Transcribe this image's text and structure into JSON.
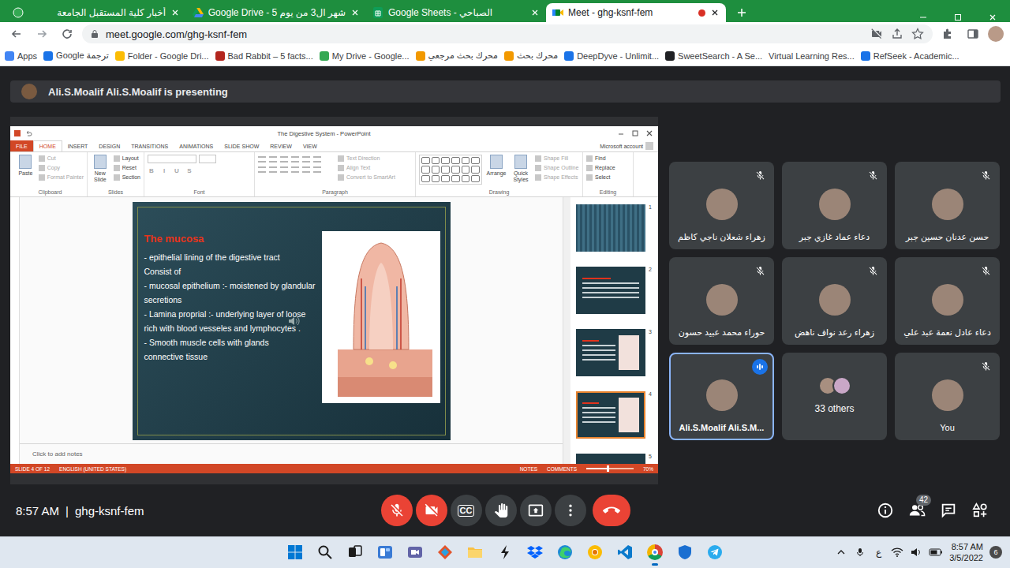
{
  "browser": {
    "tabs": [
      {
        "label": "أخبار كلية المستقبل الجامعة",
        "kind": "site",
        "selected": false,
        "recording": false
      },
      {
        "label": "شهر ال3 من يوم 5 - Google Drive",
        "kind": "drive",
        "selected": false,
        "recording": false
      },
      {
        "label": "Google Sheets - الصباحي",
        "kind": "sheets",
        "selected": false,
        "recording": false
      },
      {
        "label": "Meet - ghg-ksnf-fem",
        "kind": "meet",
        "selected": true,
        "recording": true
      }
    ],
    "address": "meet.google.com/ghg-ksnf-fem",
    "bookmarks": [
      {
        "label": "Apps",
        "color": "#4285f4"
      },
      {
        "label": "Google ترجمة",
        "color": "#1a73e8"
      },
      {
        "label": "Folder - Google Dri...",
        "color": "#fbbc04"
      },
      {
        "label": "Bad Rabbit – 5 facts...",
        "color": "#b3261e"
      },
      {
        "label": "My Drive - Google...",
        "color": "#34a853"
      },
      {
        "label": "محرك بحث مرجعي",
        "color": "#f29900"
      },
      {
        "label": "محرك بحث",
        "color": "#f29900"
      },
      {
        "label": "DeepDyve - Unlimit...",
        "color": "#1a73e8"
      },
      {
        "label": "SweetSearch - A Se...",
        "color": "#202124"
      },
      {
        "label": "Virtual Learning Res...",
        "color": null
      },
      {
        "label": "RefSeek - Academic...",
        "color": "#1a73e8"
      }
    ]
  },
  "meet": {
    "banner": "Ali.S.Moalif Ali.S.Moalif is presenting",
    "ppt": {
      "title": "The Digestive System - PowerPoint",
      "file_tab": "FILE",
      "tabs": [
        {
          "label": "HOME",
          "selected": true
        },
        {
          "label": "INSERT",
          "selected": false
        },
        {
          "label": "DESIGN",
          "selected": false
        },
        {
          "label": "TRANSITIONS",
          "selected": false
        },
        {
          "label": "ANIMATIONS",
          "selected": false
        },
        {
          "label": "SLIDE SHOW",
          "selected": false
        },
        {
          "label": "REVIEW",
          "selected": false
        },
        {
          "label": "VIEW",
          "selected": false
        }
      ],
      "account": "Microsoft account",
      "ribbon": [
        {
          "label": "Clipboard",
          "kind": "plain",
          "items": [
            {
              "label": "Paste",
              "kind": "big",
              "disabled": false
            },
            {
              "label": "Cut",
              "kind": "small",
              "disabled": true
            },
            {
              "label": "Copy",
              "kind": "small",
              "disabled": true
            },
            {
              "label": "Format Painter",
              "kind": "small",
              "disabled": true
            }
          ]
        },
        {
          "label": "Slides",
          "kind": "plain",
          "items": [
            {
              "label": "New Slide",
              "kind": "big",
              "disabled": false
            },
            {
              "label": "Layout",
              "kind": "small",
              "disabled": false
            },
            {
              "label": "Reset",
              "kind": "small",
              "disabled": false
            },
            {
              "label": "Section",
              "kind": "small",
              "disabled": false
            }
          ]
        },
        {
          "label": "Font",
          "kind": "font",
          "items": [
            {
              "label": "B",
              "kind": "fmt",
              "disabled": true
            },
            {
              "label": "I",
              "kind": "fmt",
              "disabled": true
            },
            {
              "label": "U",
              "kind": "fmt",
              "disabled": true
            },
            {
              "label": "S",
              "kind": "fmt",
              "disabled": true
            }
          ]
        },
        {
          "label": "Paragraph",
          "kind": "paragraph",
          "items": [
            {
              "label": "Text Direction",
              "kind": "small",
              "disabled": true
            },
            {
              "label": "Align Text",
              "kind": "small",
              "disabled": true
            },
            {
              "label": "Convert to SmartArt",
              "kind": "small",
              "disabled": true
            }
          ]
        },
        {
          "label": "Drawing",
          "kind": "drawing",
          "items": [
            {
              "label": "Arrange",
              "kind": "big",
              "disabled": false
            },
            {
              "label": "Quick Styles",
              "kind": "big",
              "disabled": false
            },
            {
              "label": "Shape Fill",
              "kind": "small",
              "disabled": true
            },
            {
              "label": "Shape Outline",
              "kind": "small",
              "disabled": true
            },
            {
              "label": "Shape Effects",
              "kind": "small",
              "disabled": true
            }
          ]
        },
        {
          "label": "Editing",
          "kind": "plain",
          "items": [
            {
              "label": "Find",
              "kind": "small",
              "disabled": false
            },
            {
              "label": "Replace",
              "kind": "small",
              "disabled": false
            },
            {
              "label": "Select",
              "kind": "small",
              "disabled": false
            }
          ]
        }
      ],
      "slide": {
        "title": "The mucosa",
        "lines": [
          "- epithelial lining of the digestive tract",
          "Consist of",
          "- mucosal epithelium :- moistened by glandular secretions",
          "- Lamina proprial :- underlying layer of loose rich with blood vesseles and lymphocytes .",
          "- Smooth muscle cells with glands",
          "connective tissue"
        ]
      },
      "thumbnails": [
        {
          "number": "1",
          "kind": "title",
          "selected": false
        },
        {
          "number": "2",
          "kind": "text",
          "selected": false
        },
        {
          "number": "3",
          "kind": "figure",
          "selected": false
        },
        {
          "number": "4",
          "kind": "figure",
          "selected": true
        },
        {
          "number": "5",
          "kind": "text",
          "selected": false
        }
      ],
      "notes_placeholder": "Click to add notes",
      "status": {
        "slide": "SLIDE 4 OF 12",
        "language": "ENGLISH (UNITED STATES)",
        "notes": "NOTES",
        "comments": "COMMENTS",
        "zoom": "70%",
        "zoom_level": 0.45
      }
    },
    "participants": [
      {
        "name": "زهراء شعلان ناجي كاظم",
        "kind": "person",
        "muted": true,
        "speaking": false
      },
      {
        "name": "دعاء عماد غازي جبر",
        "kind": "person",
        "muted": true,
        "speaking": false
      },
      {
        "name": "حسن عدنان حسين جبر",
        "kind": "person",
        "muted": true,
        "speaking": false
      },
      {
        "name": "حوراء محمد عبيد حسون",
        "kind": "person",
        "muted": true,
        "speaking": false
      },
      {
        "name": "زهراء رعد نواف ناهض",
        "kind": "person",
        "muted": true,
        "speaking": false
      },
      {
        "name": "دعاء عادل نعمة عبد علي",
        "kind": "person",
        "muted": true,
        "speaking": false
      },
      {
        "name": "Ali.S.Moalif Ali.S.M...",
        "kind": "person",
        "muted": false,
        "speaking": true
      },
      {
        "name": "33 others",
        "kind": "group",
        "muted": false,
        "speaking": false
      },
      {
        "name": "You",
        "kind": "person",
        "muted": true,
        "speaking": false
      }
    ],
    "time": "8:57 AM",
    "separator": "|",
    "code": "ghg-ksnf-fem",
    "controls": [
      {
        "kind": "mic",
        "off": true
      },
      {
        "kind": "camera",
        "off": true
      },
      {
        "kind": "captions",
        "label": "CC",
        "off": false
      },
      {
        "kind": "hand",
        "off": false
      },
      {
        "kind": "present",
        "off": false
      },
      {
        "kind": "more",
        "off": false
      },
      {
        "kind": "leave",
        "off": false
      }
    ],
    "side_buttons": [
      {
        "kind": "info"
      },
      {
        "kind": "people",
        "badge": "42"
      },
      {
        "kind": "chat"
      },
      {
        "kind": "activities"
      }
    ]
  },
  "taskbar": {
    "apps": [
      {
        "kind": "start",
        "active": false
      },
      {
        "kind": "search",
        "active": false
      },
      {
        "kind": "taskview",
        "active": false
      },
      {
        "kind": "widgets",
        "active": false
      },
      {
        "kind": "teams",
        "active": false
      },
      {
        "kind": "sketch",
        "active": false
      },
      {
        "kind": "files",
        "active": false
      },
      {
        "kind": "pen",
        "active": false
      },
      {
        "kind": "dropbox",
        "active": false
      },
      {
        "kind": "edge",
        "active": false
      },
      {
        "kind": "canary",
        "active": false
      },
      {
        "kind": "vscode",
        "active": false
      },
      {
        "kind": "chrome",
        "active": true
      },
      {
        "kind": "defender",
        "active": false
      },
      {
        "kind": "telegram",
        "active": false
      }
    ],
    "language": "ع",
    "time": "8:57 AM",
    "date": "3/5/2022",
    "notifications": "6"
  }
}
